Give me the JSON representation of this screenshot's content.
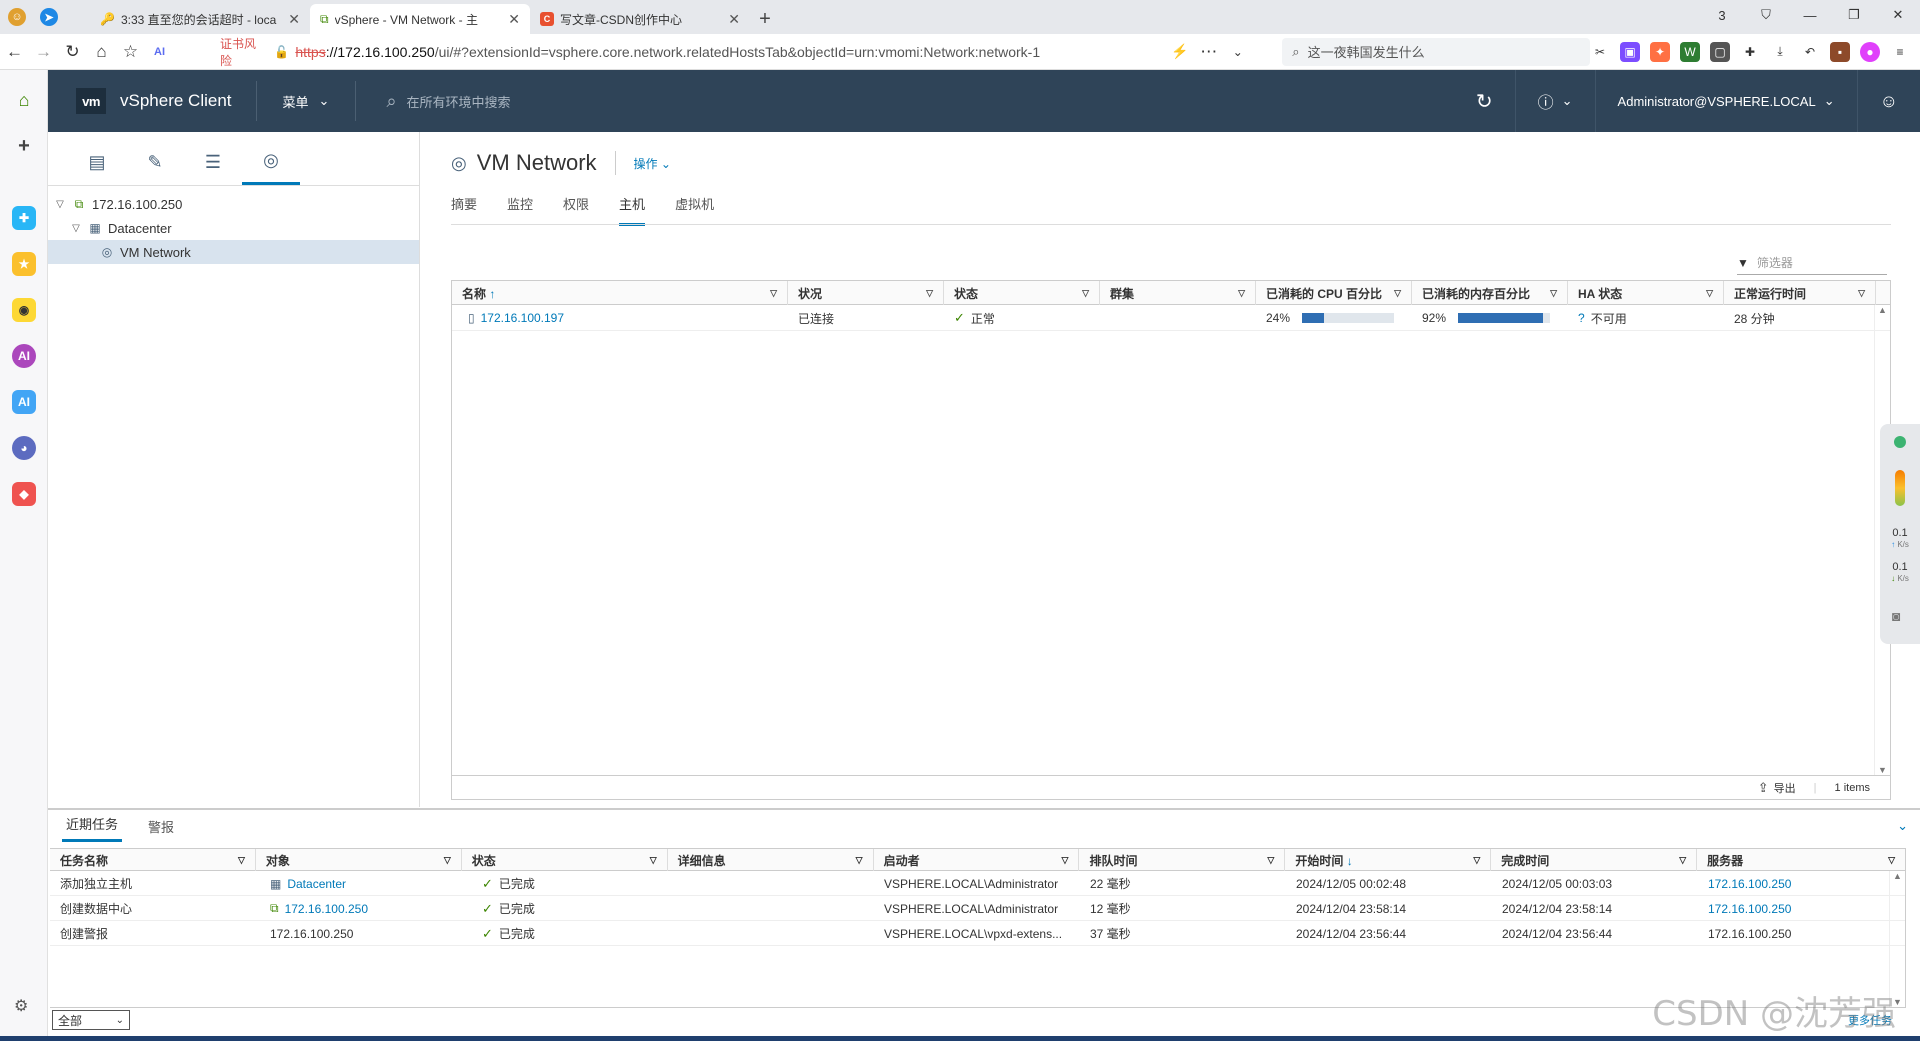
{
  "browser": {
    "tabs": [
      {
        "title": "3:33 直至您的会话超时 - loca",
        "active": false
      },
      {
        "title": "vSphere - VM Network - 主",
        "active": true
      },
      {
        "title": "写文章-CSDN创作中心",
        "active": false
      }
    ],
    "cert_warning": "证书风险",
    "url": {
      "scheme": "https",
      "host": "://172.16.100.250",
      "path": "/ui/#?extensionId=vsphere.core.network.relatedHostsTab&objectId=urn:vmomi:Network:network-1"
    },
    "search_placeholder": "这一夜韩国发生什么",
    "counter_badge": "3"
  },
  "vsphere": {
    "logo": "vm",
    "app_title": "vSphere Client",
    "menu_label": "菜单",
    "search_placeholder": "在所有环境中搜索",
    "user": "Administrator@VSPHERE.LOCAL"
  },
  "navigator": {
    "tree": [
      {
        "label": "172.16.100.250",
        "level": 0,
        "icon": "vcenter-icon"
      },
      {
        "label": "Datacenter",
        "level": 1,
        "icon": "datacenter-icon"
      },
      {
        "label": "VM Network",
        "level": 2,
        "icon": "network-icon",
        "selected": true
      }
    ]
  },
  "object": {
    "title": "VM Network",
    "actions_label": "操作",
    "tabs": [
      "摘要",
      "监控",
      "权限",
      "主机",
      "虚拟机"
    ],
    "active_tab": "主机",
    "filter_placeholder": "筛选器"
  },
  "hosts_table": {
    "columns": [
      "名称",
      "状况",
      "状态",
      "群集",
      "已消耗的 CPU 百分比",
      "已消耗的内存百分比",
      "HA 状态",
      "正常运行时间"
    ],
    "sort_arrow": "↑",
    "rows": [
      {
        "name": "172.16.100.197",
        "condition": "已连接",
        "status": "正常",
        "cluster": "",
        "cpu": "24%",
        "cpu_value": 0.24,
        "mem": "92%",
        "mem_value": 0.92,
        "ha": "不可用",
        "uptime": "28 分钟"
      }
    ],
    "export_label": "导出",
    "items_count": "1 items"
  },
  "side_widget": {
    "up": "0.1",
    "down": "0.1",
    "unit": "K/s"
  },
  "tasks": {
    "tabs": [
      "近期任务",
      "警报"
    ],
    "active_tab": "近期任务",
    "columns": [
      "任务名称",
      "对象",
      "状态",
      "详细信息",
      "启动者",
      "排队时间",
      "开始时间",
      "完成时间",
      "服务器"
    ],
    "sort_arrow": "↓",
    "rows": [
      {
        "task": "添加独立主机",
        "object": "Datacenter",
        "object_link": true,
        "object_icon": "datacenter-icon",
        "status": "已完成",
        "details": "",
        "initiator": "VSPHERE.LOCAL\\Administrator",
        "queued": "22 毫秒",
        "start": "2024/12/05 00:02:48",
        "end": "2024/12/05 00:03:03",
        "server": "172.16.100.250",
        "server_link": true
      },
      {
        "task": "创建数据中心",
        "object": "172.16.100.250",
        "object_link": true,
        "object_icon": "vcenter-icon",
        "status": "已完成",
        "details": "",
        "initiator": "VSPHERE.LOCAL\\Administrator",
        "queued": "12 毫秒",
        "start": "2024/12/04 23:58:14",
        "end": "2024/12/04 23:58:14",
        "server": "172.16.100.250",
        "server_link": true
      },
      {
        "task": "创建警报",
        "object": "172.16.100.250",
        "object_link": false,
        "object_icon": "",
        "status": "已完成",
        "details": "",
        "initiator": "VSPHERE.LOCAL\\vpxd-extens...",
        "queued": "37 毫秒",
        "start": "2024/12/04 23:56:44",
        "end": "2024/12/04 23:56:44",
        "server": "172.16.100.250",
        "server_link": false
      }
    ],
    "filter_value": "全部",
    "more_tasks": "更多任务"
  },
  "watermark": "CSDN @沈芳强",
  "colors": {
    "header": "#2f4458",
    "accent": "#0079b8",
    "ok": "#3c8500",
    "bar": "#2f6eb3"
  }
}
